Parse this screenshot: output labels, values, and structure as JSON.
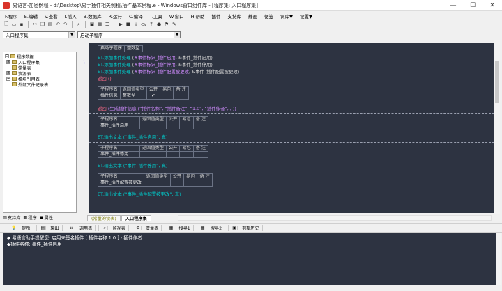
{
  "window": {
    "title": "易语言-加密例程 - d:\\Desktop\\易手插件相关例程\\插件基本例程.e - Windows窗口组件库 - [程序集: 入口程序集]",
    "controls": [
      "—",
      "☐",
      "✕"
    ]
  },
  "menu": [
    "F.程序",
    "E.编辑",
    "V.查看",
    "I.插入",
    "B.数据库",
    "R.运行",
    "C.编译",
    "T.工具",
    "W.窗口",
    "H.帮助",
    "插件",
    "支持库",
    "静画",
    "便签",
    "词库▼",
    "设置▼"
  ],
  "combos": {
    "left": "入口程序集",
    "right": "启动子程序"
  },
  "tree": {
    "items": [
      {
        "label": "程序数据",
        "level": 0,
        "exp": "⊟"
      },
      {
        "label": "入口程序集",
        "level": 1,
        "exp": "⊞"
      },
      {
        "label": "常量表",
        "level": 1,
        "exp": ""
      },
      {
        "label": "资源表",
        "level": 1,
        "exp": "⊞"
      },
      {
        "label": "模块引用表",
        "level": 1,
        "exp": "⊞"
      },
      {
        "label": "外部文件记录表",
        "level": 1,
        "exp": ""
      }
    ]
  },
  "left_tabs": [
    "支持库",
    "程序",
    "属性"
  ],
  "code": {
    "sub_header": [
      "启动子程序",
      "整数型"
    ],
    "lines1": [
      {
        "kw": "ET.添加事件处理",
        "open": " (",
        "c1": "#事件标识_插件启用",
        "sep": ", ",
        "a2": "&事件_插件启用",
        "close": ")"
      },
      {
        "kw": "ET.添加事件处理",
        "open": " (",
        "c1": "#事件标识_插件停用",
        "sep": ", ",
        "a2": "&事件_插件停用",
        "close": ")"
      },
      {
        "kw": "ET.添加事件处理",
        "open": " (",
        "c1": "#事件标识_插件配置被更改",
        "sep": ", ",
        "a2": "&事件_插件配置被更改",
        "close": ")"
      }
    ],
    "return1": "返回 ()",
    "hdr_cols": [
      "子程序名",
      "返回值类型",
      "公开",
      "易包",
      "备 注"
    ],
    "sub2_name": "插件信息",
    "sub2_type": "整数型",
    "sub2_public": "✔",
    "return2_kw": "返回",
    "return2_rest": " (生成插件信息 (“插件名称”, “插件备注”, “1.0”, “插件作者”, , ))",
    "sub3_name": "事件_插件启用",
    "line3": "ET.输出文本 (“事件_插件启用”, 真)",
    "sub4_name": "事件_插件停用",
    "line4": "ET.输出文本 (“事件_插件停用”, 真)",
    "sub5_name": "事件_插件配置被更改",
    "line5": "ET.输出文本 (“事件_插件配置被更改”, 真)"
  },
  "editor_tabs": [
    "(常量的读表)",
    "入口程序集"
  ],
  "output_tabs": [
    "提示",
    "输出",
    "调用表",
    "监视表",
    "变量表",
    "搜寻1",
    "搜寻2",
    "剪辑历史"
  ],
  "output": [
    "◆ 易语言助手提醒您: 启用未签名插件 [ 插件名称 1.0 ] - 插件作者",
    "◆插件名称: 事件_插件启用"
  ]
}
